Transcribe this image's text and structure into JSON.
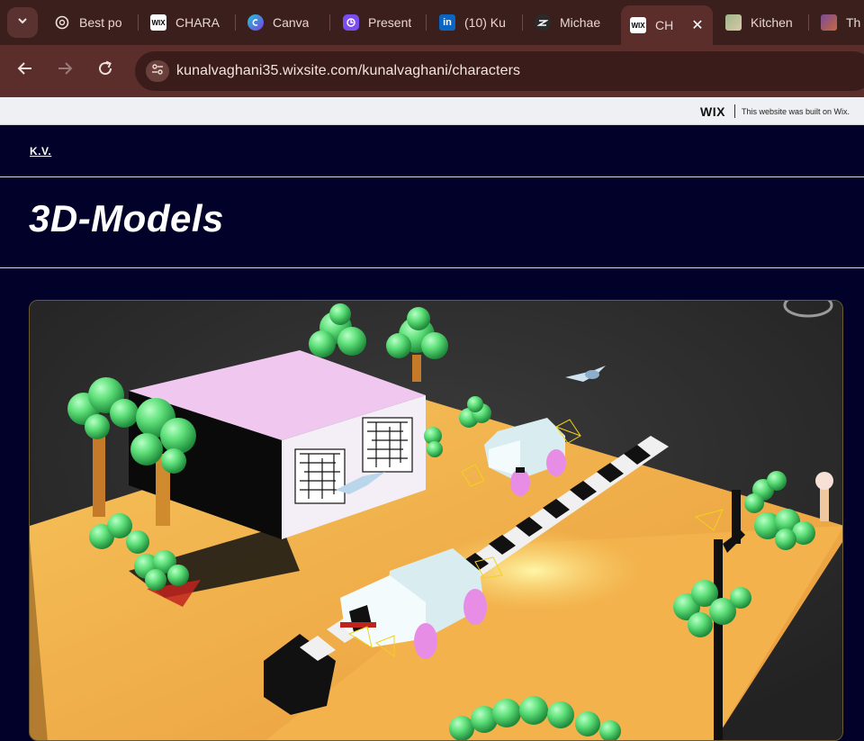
{
  "browser": {
    "tabs": [
      {
        "label": "Best po",
        "icon": "openai-icon"
      },
      {
        "label": "CHARA",
        "icon": "wix-icon",
        "icon_text": "WIX"
      },
      {
        "label": "Canva",
        "icon": "canva-icon"
      },
      {
        "label": "Present",
        "icon": "presentation-icon"
      },
      {
        "label": "(10) Ku",
        "icon": "linkedin-icon",
        "icon_text": "in"
      },
      {
        "label": "Michae",
        "icon": "site-icon"
      },
      {
        "label": "CH",
        "icon": "wix-icon",
        "icon_text": "WIX",
        "active": true
      },
      {
        "label": "Kitchen",
        "icon": "image-icon"
      },
      {
        "label": "Th",
        "icon": "image-icon"
      }
    ],
    "url": "kunalvaghani35.wixsite.com/kunalvaghani/characters"
  },
  "wix_banner": {
    "logo": "WIX",
    "text": "This website was built on Wix."
  },
  "site": {
    "brand": "K.V.",
    "title": "3D-Models"
  },
  "colors": {
    "tab_strip": "#3a1f1c",
    "toolbar": "#5b2e2b",
    "site_bg": "#02012a",
    "ground": "#f3b24c",
    "tree": "#5fe07a",
    "house_roof": "#f0c8ef"
  }
}
